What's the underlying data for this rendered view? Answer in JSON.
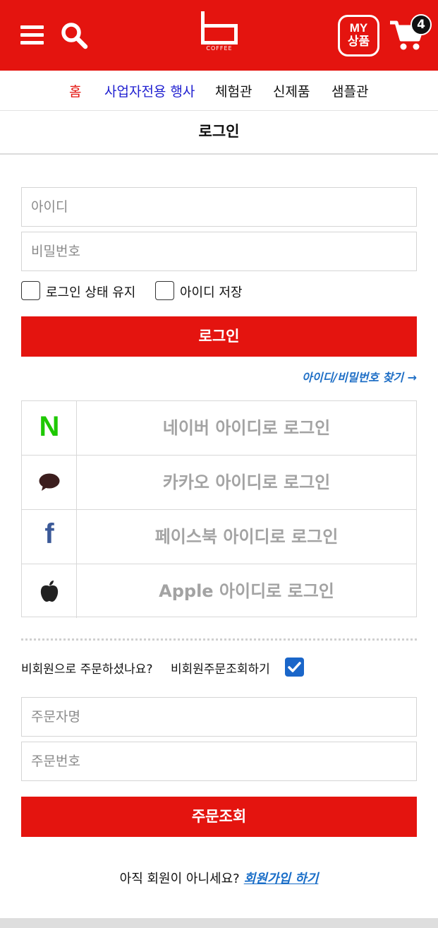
{
  "colors": {
    "brand_red": "#e4140f",
    "link_blue": "#1a6ec8",
    "nav_blue": "#1f1fd0",
    "naver_green": "#1ec800",
    "kakao_brown": "#3c1e1e",
    "facebook_blue": "#3b5998"
  },
  "header": {
    "menu_icon": "hamburger-icon",
    "search_icon": "search-icon",
    "logo_text": "COFFEE",
    "my_products": {
      "line1": "MY",
      "line2": "상품"
    },
    "cart": {
      "icon": "cart-icon",
      "count": "4"
    }
  },
  "nav": {
    "items": [
      {
        "label": "홈"
      },
      {
        "label": "사업자전용 행사"
      },
      {
        "label": "체험관"
      },
      {
        "label": "신제품"
      },
      {
        "label": "샘플관"
      }
    ]
  },
  "page": {
    "title": "로그인"
  },
  "login_form": {
    "id_placeholder": "아이디",
    "password_placeholder": "비밀번호",
    "keep_login_label": "로그인 상태 유지",
    "keep_login_checked": false,
    "save_id_label": "아이디 저장",
    "save_id_checked": false,
    "submit_label": "로그인",
    "find_link": "아이디/비밀번호 찾기 →"
  },
  "social_logins": [
    {
      "provider": "naver",
      "icon": "naver-icon",
      "icon_text": "N",
      "label": "네이버 아이디로 로그인"
    },
    {
      "provider": "kakao",
      "icon": "kakao-icon",
      "label": "카카오 아이디로 로그인"
    },
    {
      "provider": "facebook",
      "icon": "facebook-icon",
      "icon_text": "f",
      "label": "페이스북 아이디로 로그인"
    },
    {
      "provider": "apple",
      "icon": "apple-icon",
      "label": "Apple 아이디로 로그인"
    }
  ],
  "guest_order": {
    "question": "비회원으로 주문하셨나요?",
    "toggle_label": "비회원주문조회하기",
    "toggle_checked": true,
    "name_placeholder": "주문자명",
    "order_no_placeholder": "주문번호",
    "submit_label": "주문조회"
  },
  "signup": {
    "prompt": "아직 회원이 아니세요?",
    "link": "회원가입 하기"
  }
}
